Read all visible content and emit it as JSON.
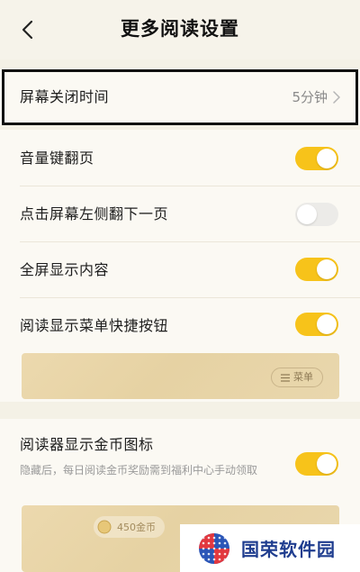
{
  "header": {
    "title": "更多阅读设置",
    "back_icon": "chevron-left-icon"
  },
  "settings": {
    "screen_off": {
      "label": "屏幕关闭时间",
      "value": "5分钟"
    },
    "volume_key_turn": {
      "label": "音量键翻页",
      "enabled": true
    },
    "tap_left_next": {
      "label": "点击屏幕左侧翻下一页",
      "enabled": false
    },
    "fullscreen": {
      "label": "全屏显示内容",
      "enabled": true
    },
    "menu_shortcut": {
      "label": "阅读显示菜单快捷按钮",
      "enabled": true,
      "preview_button": "菜单"
    },
    "coin_icon": {
      "label": "阅读器显示金币图标",
      "enabled": true,
      "description": "隐藏后，每日阅读金币奖励需到福利中心手动领取",
      "preview_text": "450金币"
    }
  },
  "watermark": {
    "text": "国荣软件园"
  },
  "colors": {
    "background": "#f4f1e6",
    "toggle_on": "#f7c31a",
    "toggle_off": "#ecebe8",
    "watermark_text": "#1f3d8f"
  }
}
